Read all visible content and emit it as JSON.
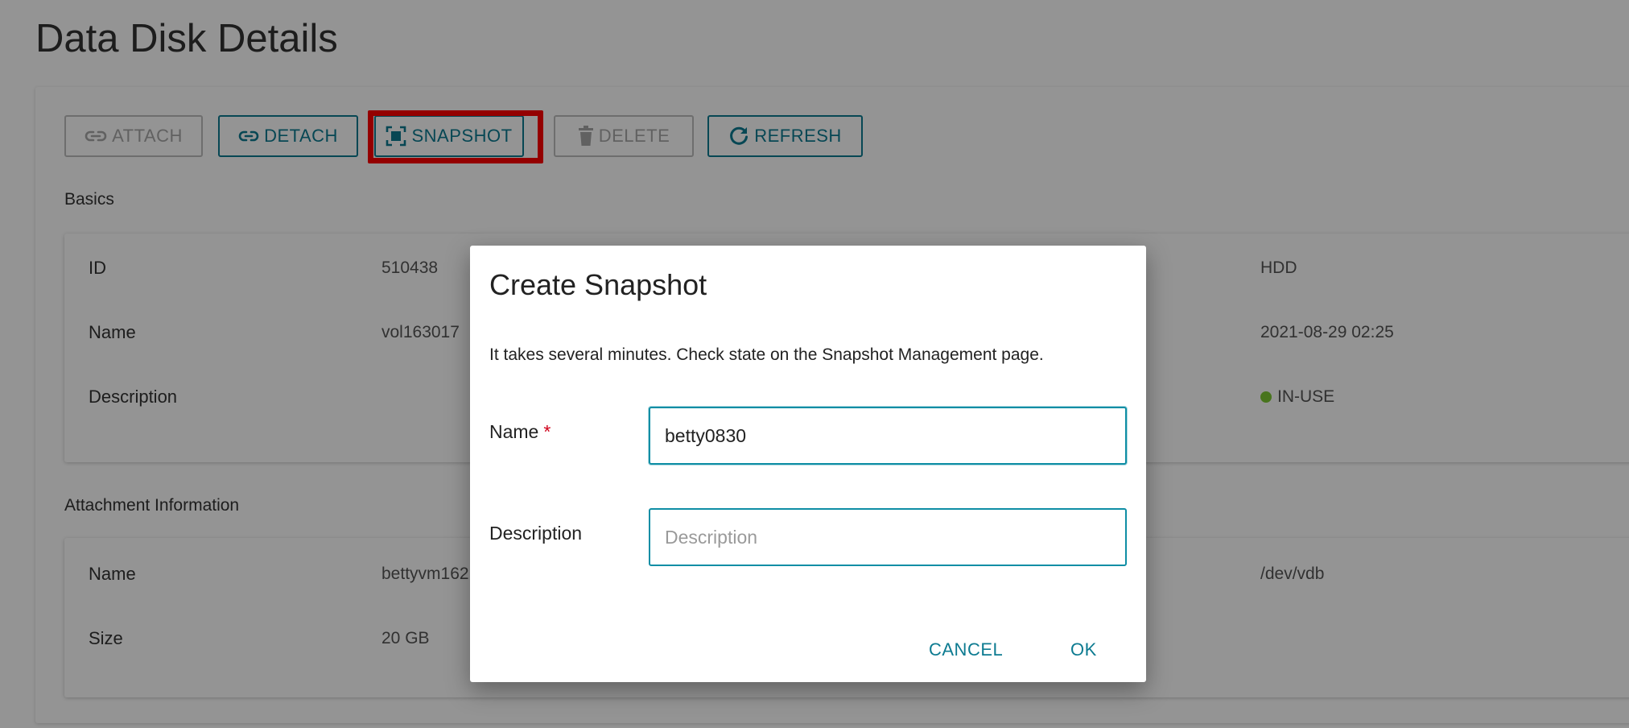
{
  "page": {
    "title": "Data Disk Details"
  },
  "toolbar": {
    "attach": "ATTACH",
    "detach": "DETACH",
    "snapshot": "SNAPSHOT",
    "delete": "DELETE",
    "refresh": "REFRESH"
  },
  "basics": {
    "label": "Basics",
    "rows": [
      {
        "label": "ID",
        "value": "510438"
      },
      {
        "label": "Name",
        "value": "vol163017"
      },
      {
        "label": "Description",
        "value": ""
      }
    ],
    "right_values": [
      "HDD",
      "2021-08-29 02:25",
      "IN-USE"
    ],
    "status_color": "#7dc832"
  },
  "attachment": {
    "label": "Attachment Information",
    "rows": [
      {
        "label": "Name",
        "value": "bettyvm162"
      },
      {
        "label": "Size",
        "value": "20 GB"
      }
    ],
    "right_values": [
      "/dev/vdb"
    ]
  },
  "dialog": {
    "title": "Create Snapshot",
    "message": "It takes several minutes. Check state on the Snapshot Management page.",
    "name_label": "Name",
    "required_mark": "*",
    "name_value": "betty0830",
    "description_label": "Description",
    "description_placeholder": "Description",
    "cancel": "CANCEL",
    "ok": "OK"
  },
  "colors": {
    "accent": "#0d7b91",
    "highlight": "#ff0000",
    "required": "#d0021b"
  }
}
